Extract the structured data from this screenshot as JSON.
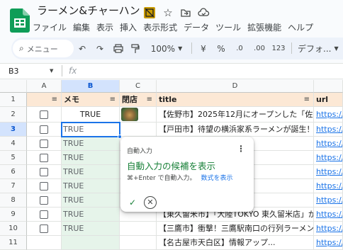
{
  "app": {
    "title": "ラーメン&チャーハン"
  },
  "menu": [
    "ファイル",
    "編集",
    "表示",
    "挿入",
    "表示形式",
    "データ",
    "ツール",
    "拡張機能",
    "ヘルプ"
  ],
  "toolbar": {
    "search_placeholder": "メニュー",
    "zoom": "100%",
    "currency": "¥",
    "percent": "%",
    "dec_decrease": ".0",
    "dec_increase": ".00",
    "number_format": "123",
    "font": "デフォ..."
  },
  "formula_bar": {
    "cell_ref": "B3",
    "fx": "fx",
    "value": ""
  },
  "columns": [
    "A",
    "B",
    "C",
    "D"
  ],
  "column_e_partial": "",
  "headers": {
    "memo": "メモ",
    "closed": "閉店",
    "title": "title",
    "url": "url"
  },
  "rows": [
    {
      "num": "1"
    },
    {
      "num": "2",
      "memo": "TRUE",
      "title": "【佐野市】2025年12月にオープンした「佐野",
      "url": "https://a"
    },
    {
      "num": "3",
      "memo": "TRUE",
      "title": "【戸田市】待望の横浜家系ラーメンが誕生！",
      "url": "https://t"
    },
    {
      "num": "4",
      "memo": "TRUE",
      "title": "気の続く屋島ラー",
      "url": "https://t"
    },
    {
      "num": "5",
      "memo": "TRUE",
      "title": "まぜそばマゼシャ",
      "url": "https://n"
    },
    {
      "num": "6",
      "memo": "TRUE",
      "title": "激アツ行列店！屋",
      "url": "https://t"
    },
    {
      "num": "7",
      "memo": "TRUE",
      "title": "でオープンから",
      "url": "https://n"
    },
    {
      "num": "8",
      "memo": "TRUE",
      "title": "ジョイ屋島店」",
      "url": "https://t"
    },
    {
      "num": "9",
      "memo": "TRUE",
      "title": "【東久留米市】「大陸TOKYO 東久留米店」が",
      "url": "https://h"
    },
    {
      "num": "10",
      "memo": "TRUE",
      "title": "【三鷹市】衝撃！三鷹駅南口の行列ラーメン店",
      "url": "https://n"
    },
    {
      "num": "11",
      "memo": "",
      "title": "【名古屋市天白区】情報アップ...",
      "url": "https://n"
    }
  ],
  "popup": {
    "header": "自動入力",
    "title": "自動入力の候補を表示",
    "hint": "⌘+Enter で自動入力。",
    "link": "数式を表示"
  },
  "colors": {
    "accent": "#188038",
    "header_fill": "#fce8d5",
    "selection": "#1a73e8"
  }
}
